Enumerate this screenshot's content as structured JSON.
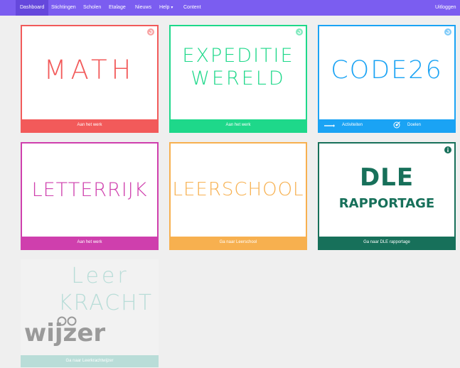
{
  "nav": {
    "items": [
      "Dashboard",
      "Stichtingen",
      "Scholen",
      "Etalage",
      "Nieuws",
      "Help",
      "Content"
    ],
    "help_caret": "▾",
    "logout": "Uitloggen"
  },
  "colors": {
    "nav_bg": "#7b5df0",
    "math": "#f25a5a",
    "expeditie": "#1ed88a",
    "code26": "#1aa3f4",
    "letterrijk": "#cf3fad",
    "leerschool": "#f7b04f",
    "dle": "#17705a",
    "leerkracht": "#b9ddd8"
  },
  "cards": {
    "math": {
      "logo": "MATH",
      "footer": "Aan het werk",
      "corner_icon": "refresh-icon"
    },
    "expeditie": {
      "logo_line1": "EXPEDITIE",
      "logo_line2": "WERELD",
      "footer": "Aan het werk",
      "corner_icon": "refresh-icon"
    },
    "code26": {
      "logo": "CODE26",
      "footer_left": "Activiteiten",
      "footer_right": "Doelen",
      "corner_icon": "refresh-icon"
    },
    "letterrijk": {
      "logo": "LETTERRIJK",
      "footer": "Aan het werk"
    },
    "leerschool": {
      "logo": "LEERSCHOOL",
      "footer": "Ga naar Leerschool"
    },
    "dle": {
      "logo_top": "DLE",
      "logo_bottom": "RAPPORTAGE",
      "footer": "Ga naar DLE rapportage",
      "corner_icon": "info-icon"
    },
    "leerkracht": {
      "logo_line1": "Leer",
      "logo_line2": "KRACHT",
      "logo_line3": "wijzer",
      "footer": "Ga naar Leerkrachtwijzer"
    }
  }
}
